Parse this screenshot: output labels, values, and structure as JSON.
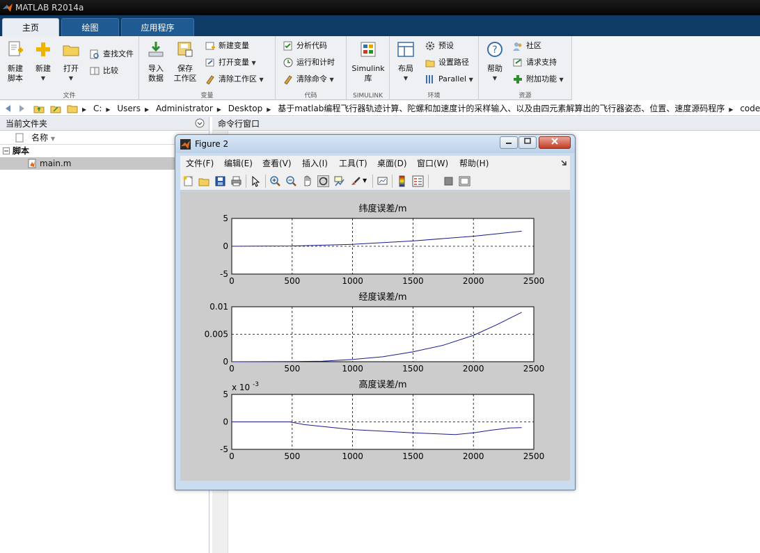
{
  "window": {
    "title": "MATLAB R2014a"
  },
  "tabs": [
    {
      "label": "主页"
    },
    {
      "label": "绘图"
    },
    {
      "label": "应用程序"
    }
  ],
  "ribbon": {
    "file": {
      "label": "文件",
      "new_script": "新建\n脚本",
      "new": "新建",
      "open": "打开",
      "find_files": "查找文件",
      "compare": "比较"
    },
    "variable": {
      "label": "变量",
      "import": "导入\n数据",
      "save": "保存\n工作区",
      "new_var": "新建变量",
      "open_var": "打开变量",
      "clear_ws": "清除工作区"
    },
    "code": {
      "label": "代码",
      "analyze": "分析代码",
      "run_time": "运行和计时",
      "clear_cmd": "清除命令"
    },
    "simulink": {
      "label": "SIMULINK",
      "btn": "Simulink\n库"
    },
    "env": {
      "label": "环境",
      "layout": "布局",
      "prefs": "预设",
      "set_path": "设置路径",
      "parallel": "Parallel"
    },
    "resources": {
      "label": "资源",
      "help": "帮助",
      "community": "社区",
      "support": "请求支持",
      "addons": "附加功能"
    }
  },
  "address": {
    "crumbs": [
      "C:",
      "Users",
      "Administrator",
      "Desktop",
      "基于matlab编程飞行器轨迹计算、陀螺和加速度计的采样输入、以及由四元素解算出的飞行器姿态、位置、速度源码程序",
      "code"
    ]
  },
  "left_panel": {
    "title": "当前文件夹",
    "column": "名称",
    "folder": "脚本",
    "file": "main.m"
  },
  "command_window": {
    "title": "命令行窗口"
  },
  "figure": {
    "title": "Figure 2",
    "menu": [
      "文件(F)",
      "编辑(E)",
      "查看(V)",
      "插入(I)",
      "工具(T)",
      "桌面(D)",
      "窗口(W)",
      "帮助(H)"
    ],
    "toolbar_icons": [
      "new-figure-icon",
      "open-file-icon",
      "save-icon",
      "print-icon",
      "pointer-icon",
      "zoom-in-icon",
      "zoom-out-icon",
      "pan-icon",
      "rotate-3d-icon",
      "data-cursor-icon",
      "brush-icon",
      "link-plot-icon",
      "colorbar-icon",
      "legend-icon",
      "hide-tools-icon",
      "show-tools-icon"
    ],
    "exponent_label": "x 10",
    "exponent_sup": "-3"
  },
  "chart_data": [
    {
      "type": "line",
      "title": "纬度误差/m",
      "xlim": [
        0,
        2500
      ],
      "ylim": [
        -5,
        5
      ],
      "xticks": [
        0,
        500,
        1000,
        1500,
        2000,
        2500
      ],
      "yticks": [
        5,
        0,
        -5
      ],
      "ytick_labels": [
        "5",
        "0",
        "-5"
      ],
      "grid": true,
      "color": "#1a1a8c",
      "x": [
        0,
        500,
        1000,
        1500,
        2000,
        2400
      ],
      "y": [
        0,
        0.05,
        0.35,
        0.95,
        1.8,
        2.7
      ]
    },
    {
      "type": "line",
      "title": "经度误差/m",
      "xlim": [
        0,
        2500
      ],
      "ylim": [
        0,
        0.01
      ],
      "xticks": [
        0,
        500,
        1000,
        1500,
        2000,
        2500
      ],
      "yticks": [
        0.01,
        0.005,
        0
      ],
      "ytick_labels": [
        "0.01",
        "0.005",
        "0"
      ],
      "grid": true,
      "color": "#1a1a8c",
      "x": [
        0,
        500,
        750,
        1000,
        1250,
        1500,
        1750,
        2000,
        2200,
        2400
      ],
      "y": [
        0,
        3e-05,
        0.0001,
        0.0004,
        0.0009,
        0.0018,
        0.003,
        0.0048,
        0.0068,
        0.009
      ]
    },
    {
      "type": "line",
      "title": "高度误差/m",
      "xlim": [
        0,
        2500
      ],
      "ylim": [
        -5,
        5
      ],
      "xticks": [
        0,
        500,
        1000,
        1500,
        2000,
        2500
      ],
      "yticks": [
        5,
        0,
        -5
      ],
      "ytick_labels": [
        "5",
        "0",
        "-5"
      ],
      "grid": true,
      "color": "#1a1a8c",
      "x": [
        0,
        480,
        600,
        1000,
        1500,
        1850,
        2000,
        2150,
        2300,
        2400
      ],
      "y": [
        0,
        0,
        -0.5,
        -1.4,
        -2.0,
        -2.3,
        -2.0,
        -1.5,
        -1.1,
        -1.05
      ]
    }
  ]
}
